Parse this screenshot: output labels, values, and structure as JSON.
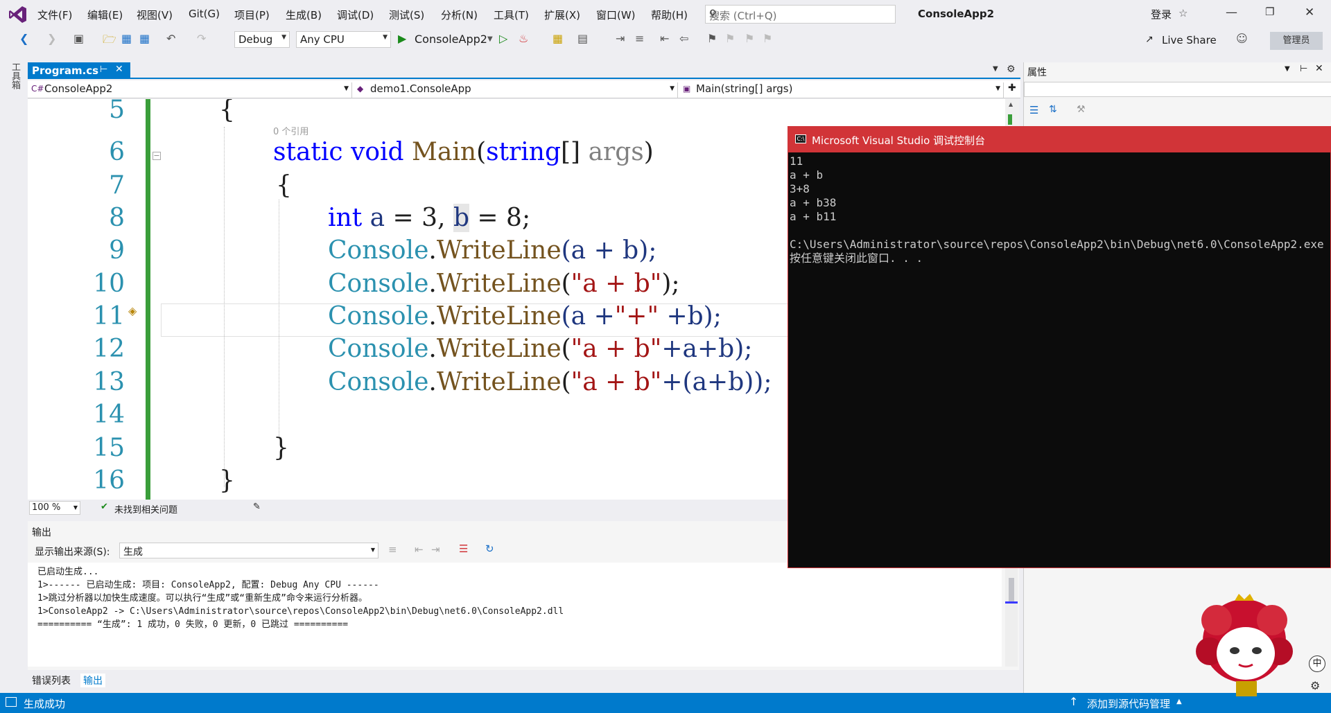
{
  "menubar": {
    "items": [
      "文件(F)",
      "编辑(E)",
      "视图(V)",
      "Git(G)",
      "项目(P)",
      "生成(B)",
      "调试(D)",
      "测试(S)",
      "分析(N)",
      "工具(T)",
      "扩展(X)",
      "窗口(W)",
      "帮助(H)"
    ],
    "search_placeholder": "搜索 (Ctrl+Q)",
    "app_title": "ConsoleApp2",
    "login": "登录"
  },
  "toolbar": {
    "config": "Debug",
    "platform": "Any CPU",
    "run_target": "ConsoleApp2",
    "live_share": "Live Share",
    "admin": "管理员"
  },
  "toolbox": {
    "label": "工具箱"
  },
  "editor": {
    "tab": "Program.cs",
    "nav_project": "ConsoleApp2",
    "nav_class": "demo1.ConsoleApp",
    "nav_member": "Main(string[] args)",
    "ref_hint": "0 个引用",
    "line_numbers": [
      "5",
      "6",
      "7",
      "8",
      "9",
      "10",
      "11",
      "12",
      "13",
      "14",
      "15",
      "16"
    ],
    "zoom": "100 %",
    "issues": "未找到相关问题"
  },
  "code": {
    "l5": "{",
    "l6_kw1": "static",
    "l6_kw2": "void",
    "l6_fn": "Main",
    "l6_p1": "(",
    "l6_ty": "string",
    "l6_p2": "[] ",
    "l6_arg": "args",
    "l6_p3": ")",
    "l7": "{",
    "l8_kw": "int",
    "l8_rest_a": " a ",
    "l8_rest_b": "= 3, ",
    "l8_b": "b",
    "l8_end": " = 8;",
    "console": "Console",
    "dot": ".",
    "writeline": "WriteLine",
    "l9_args": "(a + b);",
    "l10_open": "(",
    "l10_str": "\"a + b\"",
    "l10_close": ");",
    "l11_a": "(a +",
    "l11_str": "\"+\"",
    "l11_b": " +b);",
    "l12_open": "(",
    "l12_str": "\"a + b\"",
    "l12_rest": "+a+b);",
    "l13_open": "(",
    "l13_str": "\"a + b\"",
    "l13_rest": "+(a+b));",
    "l15": "}",
    "l16": "}"
  },
  "properties": {
    "title": "属性"
  },
  "output": {
    "title": "输出",
    "source_label": "显示输出来源(S):",
    "source_value": "生成",
    "lines": [
      "已启动生成...",
      "1>------ 已启动生成: 项目: ConsoleApp2, 配置: Debug Any CPU ------",
      "1>跳过分析器以加快生成速度。可以执行“生成”或“重新生成”命令来运行分析器。",
      "1>ConsoleApp2 -> C:\\Users\\Administrator\\source\\repos\\ConsoleApp2\\bin\\Debug\\net6.0\\ConsoleApp2.dll",
      "========== “生成”: 1 成功，0 失败，0 更新，0 已跳过 =========="
    ]
  },
  "bottom_tabs": {
    "errors": "错误列表",
    "output": "输出"
  },
  "statusbar": {
    "left": "生成成功",
    "right": "添加到源代码管理"
  },
  "console": {
    "title": "Microsoft Visual Studio 调试控制台",
    "icon": "C:\\",
    "lines": [
      "11",
      "a + b",
      "3+8",
      "a + b38",
      "a + b11",
      "",
      "C:\\Users\\Administrator\\source\\repos\\ConsoleApp2\\bin\\Debug\\net6.0\\ConsoleApp2.exe",
      "按任意键关闭此窗口. . ."
    ]
  },
  "colors": {
    "accent": "#007acc",
    "console_title": "#d13438",
    "keyword": "#0000ff",
    "type": "#2b91af",
    "string": "#a31515"
  }
}
